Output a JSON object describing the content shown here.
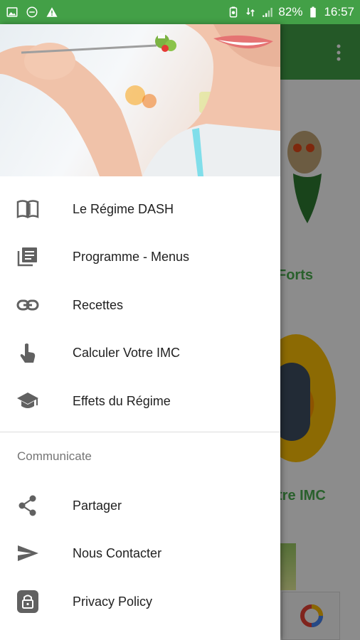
{
  "status_bar": {
    "battery": "82%",
    "time": "16:57"
  },
  "background": {
    "card_text_1": "Forts",
    "card_text_2": "tre IMC"
  },
  "drawer": {
    "items": [
      {
        "label": "Le Régime DASH",
        "icon": "book-open-icon"
      },
      {
        "label": "Programme - Menus",
        "icon": "library-books-icon"
      },
      {
        "label": "Recettes",
        "icon": "link-icon"
      },
      {
        "label": "Calculer Votre IMC",
        "icon": "touch-hand-icon"
      },
      {
        "label": "Effets du Régime",
        "icon": "graduation-cap-icon"
      }
    ],
    "section": "Communicate",
    "section_items": [
      {
        "label": "Partager",
        "icon": "share-icon"
      },
      {
        "label": "Nous Contacter",
        "icon": "send-icon"
      },
      {
        "label": "Privacy Policy",
        "icon": "lock-icon"
      }
    ]
  },
  "colors": {
    "primary": "#43a047",
    "accent_text": "#4caf50"
  }
}
